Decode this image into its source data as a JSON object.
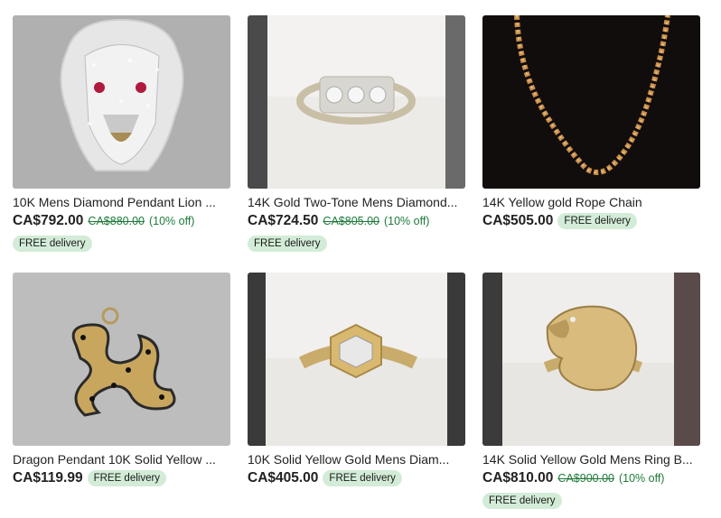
{
  "listings": [
    {
      "title": "10K Mens Diamond Pendant Lion ...",
      "price": "CA$792.00",
      "original_price": "CA$880.00",
      "discount": "(10% off)",
      "shipping": "FREE delivery",
      "image": "lion-pendant"
    },
    {
      "title": "14K Gold Two-Tone Mens Diamond...",
      "price": "CA$724.50",
      "original_price": "CA$805.00",
      "discount": "(10% off)",
      "shipping": "FREE delivery",
      "image": "two-tone-ring"
    },
    {
      "title": "14K Yellow gold Rope Chain",
      "price": "CA$505.00",
      "shipping": "FREE delivery",
      "image": "rope-chain"
    },
    {
      "title": "Dragon Pendant 10K Solid Yellow ...",
      "price": "CA$119.99",
      "shipping": "FREE delivery",
      "image": "dragon-pendant"
    },
    {
      "title": "10K Solid Yellow Gold Mens Diam...",
      "price": "CA$405.00",
      "shipping": "FREE delivery",
      "image": "hexagon-ring"
    },
    {
      "title": "14K Solid Yellow Gold Mens Ring B...",
      "price": "CA$810.00",
      "original_price": "CA$900.00",
      "discount": "(10% off)",
      "shipping": "FREE delivery",
      "image": "eagle-ring"
    }
  ]
}
